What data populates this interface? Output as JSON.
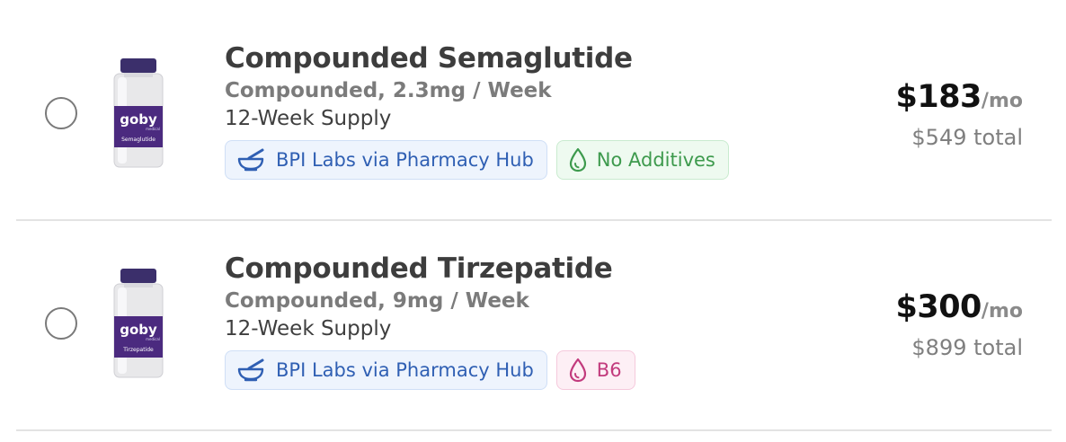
{
  "products": [
    {
      "title": "Compounded Semaglutide",
      "dose": "Compounded, 2.3mg / Week",
      "supply": "12-Week Supply",
      "pharmacy_tag": "BPI Labs via Pharmacy Hub",
      "feature_tag": "No Additives",
      "feature_color": "#3d9a4d",
      "price": "$183",
      "per": "/mo",
      "total": "$549 total",
      "vial_brand": "goby",
      "vial_brand_sub": "medical",
      "vial_label": "Semaglutide",
      "selected": false
    },
    {
      "title": "Compounded Tirzepatide",
      "dose": "Compounded, 9mg / Week",
      "supply": "12-Week Supply",
      "pharmacy_tag": "BPI Labs via Pharmacy Hub",
      "feature_tag": "B6",
      "feature_color": "#c23b7d",
      "price": "$300",
      "per": "/mo",
      "total": "$899 total",
      "vial_brand": "goby",
      "vial_brand_sub": "medical",
      "vial_label": "Tirzepatide",
      "selected": false
    }
  ],
  "icons": {
    "pharmacy": "mortar-pestle-icon",
    "feature": "droplet-icon",
    "product": "vial-image"
  },
  "colors": {
    "vial_cap": "#3b2f6b",
    "vial_label": "#4b2a7f",
    "pharmacy_tag": "#2f5fb3"
  }
}
